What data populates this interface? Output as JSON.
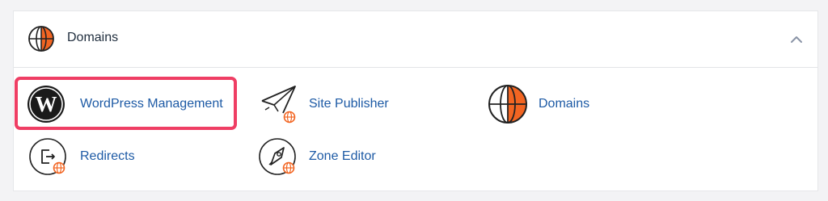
{
  "section": {
    "title": "Domains",
    "header_icon": "globe-icon",
    "collapse_icon": "chevron-up-icon"
  },
  "tiles": [
    {
      "label": "WordPress Management",
      "icon": "wordpress-icon",
      "highlighted": true
    },
    {
      "label": "Site Publisher",
      "icon": "paper-plane-icon"
    },
    {
      "label": "Domains",
      "icon": "globe-icon"
    },
    {
      "label": "Redirects",
      "icon": "redirect-icon"
    },
    {
      "label": "Zone Editor",
      "icon": "rocket-icon"
    }
  ],
  "colors": {
    "link": "#1d5aa5",
    "accent_orange": "#f26522",
    "highlight_border": "#ef3e64",
    "background": "#f3f3f5"
  }
}
